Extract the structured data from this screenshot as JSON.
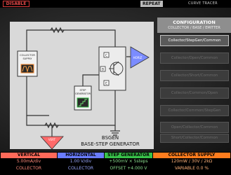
{
  "topbar": {
    "disable_label": "DISABLE",
    "repeat_label": "REPEAT",
    "mode_label": "CURVE TRACER"
  },
  "diagram": {
    "collector_supply_label_1": "COLLECTOR",
    "collector_supply_label_2": "SUPPLY",
    "step_generator_label_1": "STEP",
    "step_generator_label_2": "GENERATOR",
    "transistor_c": "C",
    "transistor_b": "B",
    "transistor_e": "E",
    "horiz_label": "HORIZ",
    "vert_label": "VERT",
    "title_line1": "BSGEN",
    "title_line2": "BASE-STEP GENERATOR"
  },
  "config": {
    "title": "CONFIGURATION",
    "subtitle": "COLLECTOR / BASE / EMITTER",
    "options": [
      "Collector/StepGen/Common",
      "Collector/Open/Common",
      "Collector/Short/Common",
      "Collector/Common/Open",
      "Collector/Common/StepGen",
      "Open/Collector/Common",
      "Short/Collector/Common"
    ]
  },
  "readouts": {
    "vertical": {
      "title": "VERTICAL",
      "line1": "5.00mA/div",
      "line2": "COLLECTOR"
    },
    "horizontal": {
      "title": "HORIZONTAL",
      "line1": "1.00 V/div",
      "line2": "COLLECTOR"
    },
    "step_generator": {
      "title": "STEP GENERATOR",
      "line1": "+500mV × 5steps",
      "line2": "OFFSET +4.000 V"
    },
    "collector_supply": {
      "title": "COLLECTOR SUPPLY",
      "line1": "120mW / 30V / 2kΩ",
      "line2": "VARIABLE  0.0 %"
    }
  },
  "colors": {
    "vertical": "#ff6a5a",
    "horizontal": "#6a7cff",
    "step_generator": "#39c24a",
    "collector_supply": "#ff7d1e",
    "disable": "#e84a4a"
  }
}
